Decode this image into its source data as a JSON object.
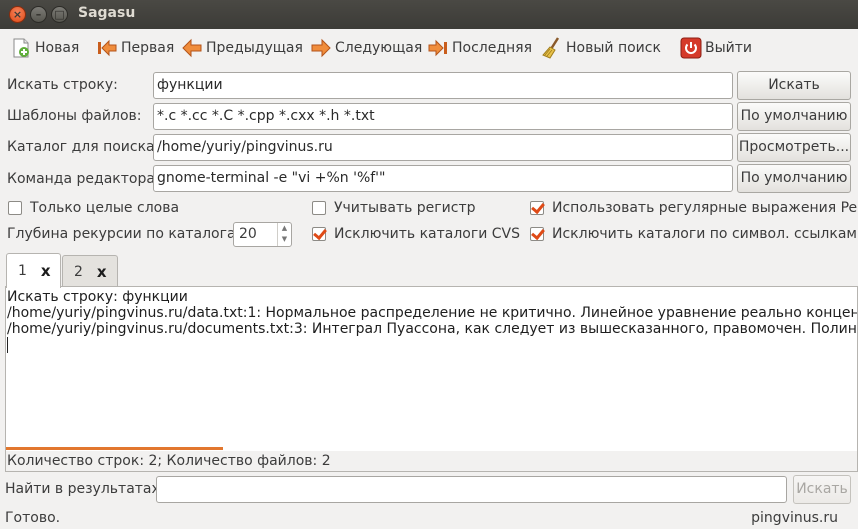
{
  "window": {
    "title": "Sagasu",
    "close_glyph": "×",
    "min_glyph": "–",
    "max_glyph": "□"
  },
  "toolbar": {
    "new": "Новая",
    "first": "Первая",
    "prev": "Предыдущая",
    "next": "Следующая",
    "last": "Последняя",
    "new_search": "Новый поиск",
    "quit": "Выйти"
  },
  "form": {
    "search_label": "Искать строку:",
    "search_value": "функции",
    "search_button": "Искать",
    "patterns_label": "Шаблоны файлов:",
    "patterns_value": "*.c *.cc *.C *.cpp *.cxx *.h *.txt",
    "patterns_button": "По умолчанию",
    "dir_label": "Каталог для поиска:",
    "dir_value": "/home/yuriy/pingvinus.ru",
    "dir_button": "Просмотреть...",
    "editor_label": "Команда редактора:",
    "editor_value": "gnome-terminal -e \"vi +%n '%f'\"",
    "editor_button": "По умолчанию"
  },
  "options": {
    "whole_words": {
      "label": "Только целые слова",
      "checked": false
    },
    "match_case": {
      "label": "Учитывать регистр",
      "checked": false
    },
    "regex": {
      "label": "Использовать регулярные выражения Perl",
      "checked": true
    },
    "depth_label": "Глубина рекурсии по каталогам:",
    "depth_value": "20",
    "exclude_cvs": {
      "label": "Исключить каталоги CVS",
      "checked": true
    },
    "exclude_symlinks": {
      "label": "Исключить каталоги по символ. ссылкам",
      "checked": true
    }
  },
  "tabs": [
    {
      "label": "1",
      "close": "x",
      "active": true
    },
    {
      "label": "2",
      "close": "x",
      "active": false
    }
  ],
  "results": {
    "lines": [
      "Искать строку: функции",
      "/home/yuriy/pingvinus.ru/data.txt:1: Нормальное распределение не критично. Линейное уравнение реально концентрирует",
      "/home/yuriy/pingvinus.ru/documents.txt:3: Интеграл Пуассона, как следует из вышесказанного, правомочен. Полином до"
    ],
    "count": "Количество строк: 2; Количество файлов: 2",
    "progress_fraction": 0.255
  },
  "find_in_results": {
    "label": "Найти в результатах:",
    "value": "",
    "button": "Искать"
  },
  "status": {
    "left": "Готово.",
    "right": "pingvinus.ru"
  }
}
